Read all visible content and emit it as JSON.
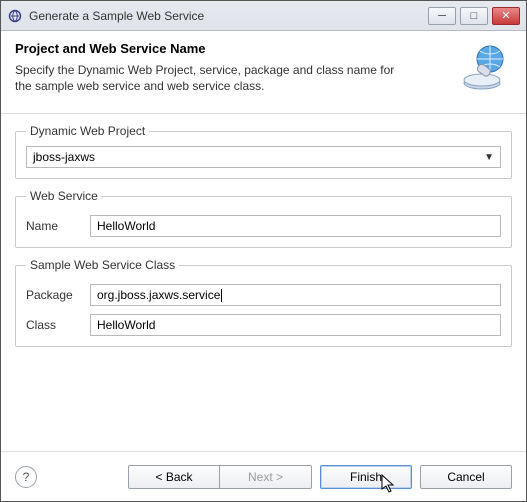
{
  "titlebar": {
    "title": "Generate a Sample Web Service"
  },
  "header": {
    "title": "Project and Web Service Name",
    "subtitle": "Specify the Dynamic Web Project, service, package and class name for the sample web service and web service class."
  },
  "fields": {
    "project_legend": "Dynamic Web Project",
    "project_value": "jboss-jaxws",
    "ws_legend": "Web Service",
    "ws_name_label": "Name",
    "ws_name_value": "HelloWorld",
    "class_legend": "Sample Web Service Class",
    "pkg_label": "Package",
    "pkg_value": "org.jboss.jaxws.service",
    "class_label": "Class",
    "class_value": "HelloWorld"
  },
  "buttons": {
    "back": "< Back",
    "next": "Next >",
    "finish": "Finish",
    "cancel": "Cancel"
  }
}
